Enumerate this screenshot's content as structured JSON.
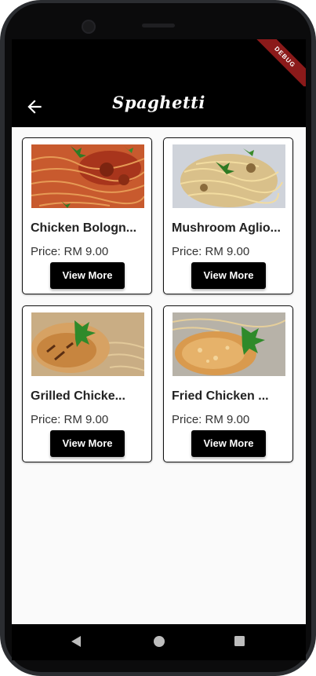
{
  "app": {
    "title": "Spaghetti",
    "debug_banner": "DEBUG"
  },
  "items": [
    {
      "name": "Chicken Bologn...",
      "price": "Price: RM 9.00",
      "button": "View More",
      "image": "spaghetti-bolognese"
    },
    {
      "name": "Mushroom Aglio...",
      "price": "Price: RM 9.00",
      "button": "View More",
      "image": "mushroom-aglio-olio"
    },
    {
      "name": "Grilled Chicke...",
      "price": "Price: RM 9.00",
      "button": "View More",
      "image": "grilled-chicken-spaghetti"
    },
    {
      "name": "Fried Chicken ...",
      "price": "Price: RM 9.00",
      "button": "View More",
      "image": "fried-chicken-spaghetti"
    }
  ],
  "icons": {
    "back": "arrow-left-icon",
    "nav_back": "triangle-back-icon",
    "nav_home": "circle-home-icon",
    "nav_recents": "square-recents-icon"
  }
}
